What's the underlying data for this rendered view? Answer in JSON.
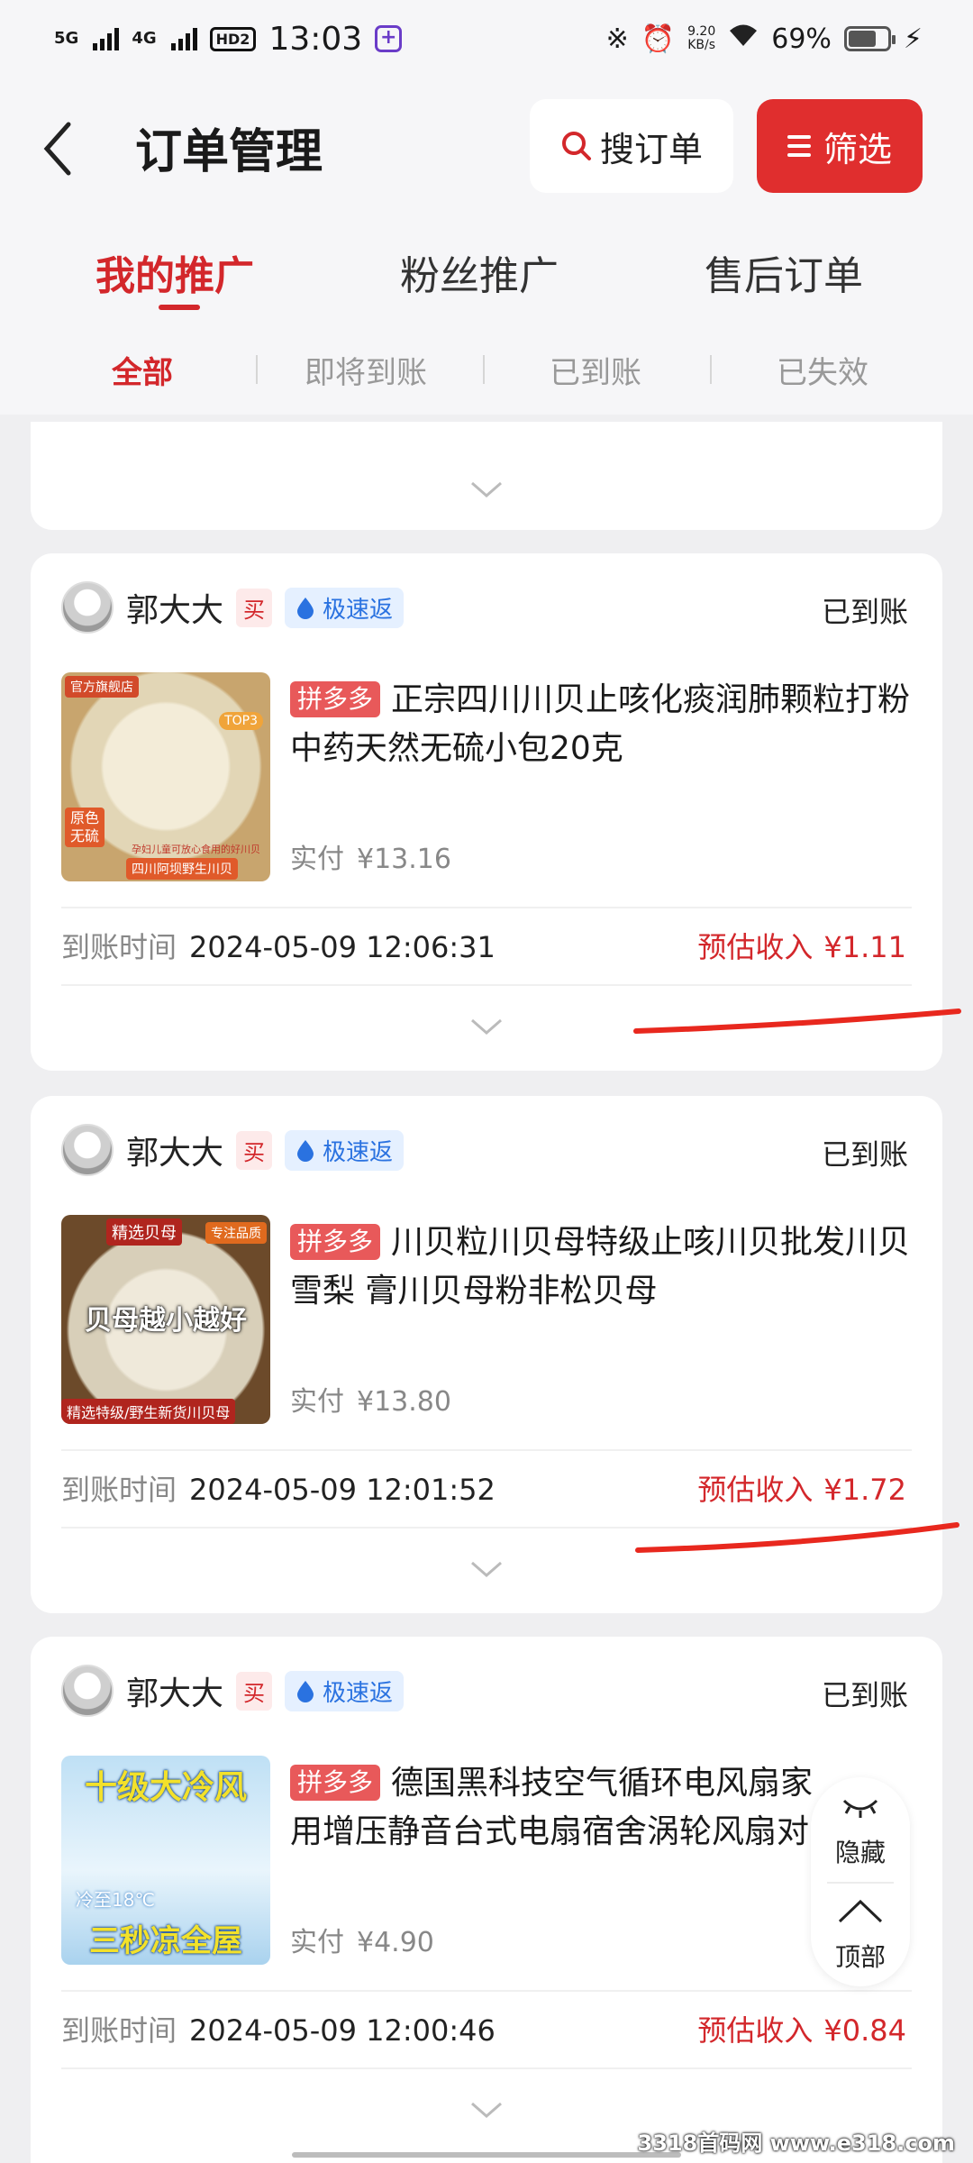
{
  "status_bar": {
    "net1": "5G",
    "net2": "4G",
    "hd": "HD2",
    "time": "13:03",
    "speed_value": "9.20",
    "speed_unit": "KB/s",
    "battery": "69%"
  },
  "header": {
    "title": "订单管理",
    "search_label": "搜订单",
    "filter_label": "筛选"
  },
  "tabs": [
    {
      "label": "我的推广",
      "active": true
    },
    {
      "label": "粉丝推广",
      "active": false
    },
    {
      "label": "售后订单",
      "active": false
    }
  ],
  "subtabs": [
    {
      "label": "全部",
      "active": true
    },
    {
      "label": "即将到账",
      "active": false
    },
    {
      "label": "已到账",
      "active": false
    },
    {
      "label": "已失效",
      "active": false
    }
  ],
  "orders": [
    {
      "buyer": "郭大大",
      "buy_badge": "买",
      "speed_badge": "极速返",
      "status": "已到账",
      "platform_tag": "拼多多",
      "title": "正宗四川川贝止咳化痰润肺颗粒打粉中药天然无硫小包20克",
      "paid_label": "实付",
      "paid_amount": "¥13.16",
      "arrive_label": "到账时间",
      "arrive_time": "2024-05-09  12:06:31",
      "est_label": "预估收入",
      "est_amount": "¥1.11",
      "thumb": {
        "tag1": "官方旗舰店",
        "tag2": "TOP3",
        "corner": "原色\n无硫",
        "bottom": "四川阿坝野生川贝",
        "sub": "孕妇儿童可放心食用的好川贝"
      }
    },
    {
      "buyer": "郭大大",
      "buy_badge": "买",
      "speed_badge": "极速返",
      "status": "已到账",
      "platform_tag": "拼多多",
      "title": "川贝粒川贝母特级止咳川贝批发川贝雪梨 膏川贝母粉非松贝母",
      "paid_label": "实付",
      "paid_amount": "¥13.80",
      "arrive_label": "到账时间",
      "arrive_time": "2024-05-09  12:01:52",
      "est_label": "预估收入",
      "est_amount": "¥1.72",
      "thumb": {
        "tag1": "精选贝母",
        "tag2": "专注品质",
        "big": "贝母越小越好",
        "bottom": "精选特级/野生新货川贝母"
      }
    },
    {
      "buyer": "郭大大",
      "buy_badge": "买",
      "speed_badge": "极速返",
      "status": "已到账",
      "platform_tag": "拼多多",
      "title": "德国黑科技空气循环电风扇家用增压静音台式电扇宿舍涡轮风扇对",
      "paid_label": "实付",
      "paid_amount": "¥4.90",
      "arrive_label": "到账时间",
      "arrive_time": "2024-05-09  12:00:46",
      "est_label": "预估收入",
      "est_amount": "¥0.84",
      "thumb": {
        "top": "十级大冷风",
        "mid": "冷至18℃",
        "bottom": "三秒凉全屋"
      }
    }
  ],
  "float_panel": {
    "hide_label": "隐藏",
    "top_label": "顶部"
  },
  "watermark": "3318首码网 www.e318.com",
  "colors": {
    "accent": "#d3272b",
    "filter_bg": "#e02e2e",
    "pdd_tag": "#e8595a",
    "speed_badge": "#2a72e0"
  }
}
